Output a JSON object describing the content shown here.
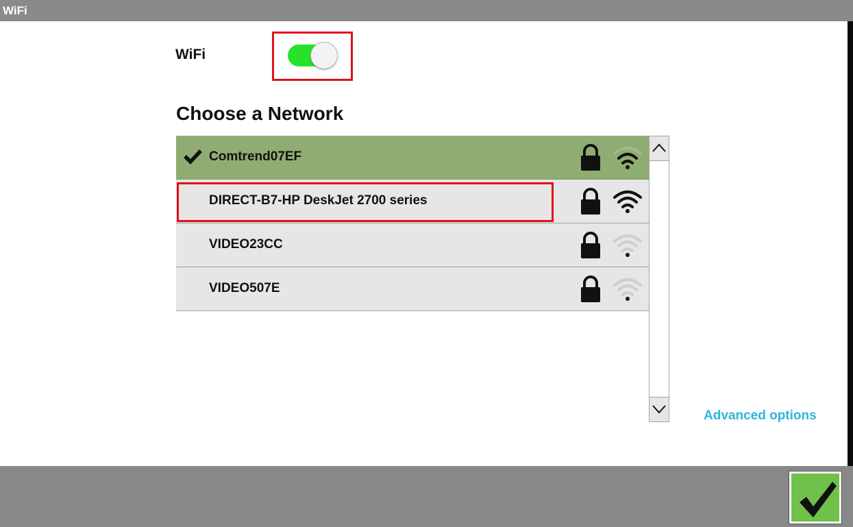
{
  "window": {
    "title": "WiFi"
  },
  "wifi": {
    "label": "WiFi",
    "enabled": true,
    "toggle_color": "#26e32a"
  },
  "networks": {
    "title": "Choose a Network",
    "items": [
      {
        "name": "Comtrend07EF",
        "connected": true,
        "secured": true,
        "signal_icon": "wifi-signal-icon",
        "signal_strength": "medium"
      },
      {
        "name": "DIRECT-B7-HP DeskJet 2700 series",
        "connected": false,
        "secured": true,
        "signal_icon": "wifi-signal-icon",
        "signal_strength": "strong"
      },
      {
        "name": "VIDEO23CC",
        "connected": false,
        "secured": true,
        "signal_icon": "wifi-signal-icon",
        "signal_strength": "weak"
      },
      {
        "name": "VIDEO507E",
        "connected": false,
        "secured": true,
        "signal_icon": "wifi-signal-icon",
        "signal_strength": "weak"
      }
    ],
    "selected_color": "#8fad72"
  },
  "advanced": {
    "label": "Advanced options",
    "color": "#2eb5de"
  },
  "footer": {
    "confirm_icon": "checkmark-icon",
    "confirm_color": "#70c04c"
  },
  "highlights": {
    "color": "#e0101b"
  }
}
